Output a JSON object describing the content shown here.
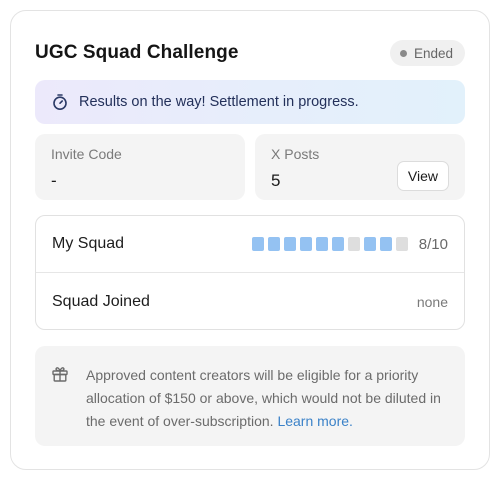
{
  "card": {
    "title": "UGC Squad Challenge",
    "status_badge": "Ended"
  },
  "notice": {
    "icon": "stopwatch-icon",
    "text": "Results on the way! Settlement in progress."
  },
  "stats": {
    "invite_code": {
      "label": "Invite Code",
      "value": "-"
    },
    "x_posts": {
      "label": "X Posts",
      "value": "5",
      "button_label": "View"
    }
  },
  "squad": {
    "my_squad": {
      "label": "My Squad",
      "segments": [
        true,
        true,
        true,
        true,
        true,
        true,
        false,
        true,
        true,
        false
      ],
      "count_text": "8/10"
    },
    "squad_joined": {
      "label": "Squad Joined",
      "value": "none"
    }
  },
  "info": {
    "icon": "gift-icon",
    "text": "Approved content creators will be eligible for a priority allocation of $150 or above, which would not be diluted in the event of over-subscription.",
    "link_label": "Learn more."
  },
  "colors": {
    "segment_filled": "#94c2f2",
    "segment_empty": "#dedede",
    "link": "#3b82c8",
    "notice_text": "#23305a"
  }
}
